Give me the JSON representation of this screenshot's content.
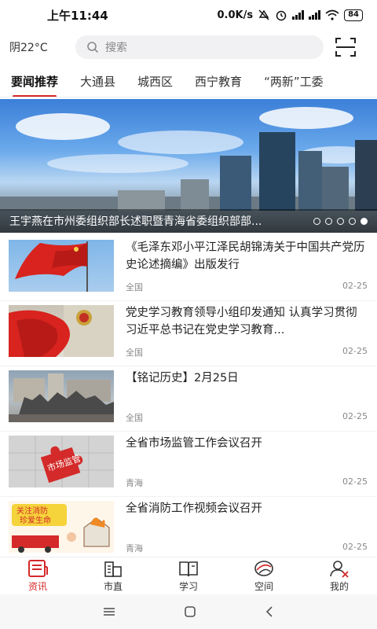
{
  "status_bar": {
    "time": "上午11:44",
    "speed": "0.0K/s",
    "battery": "84"
  },
  "header": {
    "weather": "阴22°C",
    "search_placeholder": "搜索"
  },
  "tabs": [
    {
      "label": "要闻推荐",
      "active": true
    },
    {
      "label": "大通县",
      "active": false
    },
    {
      "label": "城西区",
      "active": false
    },
    {
      "label": "西宁教育",
      "active": false
    },
    {
      "label": "“两新”工委",
      "active": false
    }
  ],
  "banner": {
    "caption": "王宇燕在市州委组织部长述职暨青海省委组织部部..."
  },
  "news": [
    {
      "title": "《毛泽东邓小平江泽民胡锦涛关于中国共产党历史论述摘编》出版发行",
      "source": "全国",
      "date": "02-25"
    },
    {
      "title": "党史学习教育领导小组印发通知 认真学习贯彻习近平总书记在党史学习教育...",
      "source": "全国",
      "date": "02-25"
    },
    {
      "title": "【铭记历史】2月25日",
      "source": "全国",
      "date": "02-25"
    },
    {
      "title": "全省市场监管工作会议召开",
      "source": "青海",
      "date": "02-25"
    },
    {
      "title": "全省消防工作视频会议召开",
      "source": "青海",
      "date": "02-25"
    }
  ],
  "thumb_text": {
    "puzzle": "市场监管",
    "fire_1": "关注消防",
    "fire_2": "珍爱生命"
  },
  "bottom_nav": [
    {
      "label": "资讯",
      "icon": "news-icon",
      "active": true
    },
    {
      "label": "市直",
      "icon": "building-icon",
      "active": false
    },
    {
      "label": "学习",
      "icon": "book-icon",
      "active": false
    },
    {
      "label": "空间",
      "icon": "space-icon",
      "active": false
    },
    {
      "label": "我的",
      "icon": "profile-icon",
      "active": false
    }
  ],
  "colors": {
    "accent": "#d42a2a"
  }
}
